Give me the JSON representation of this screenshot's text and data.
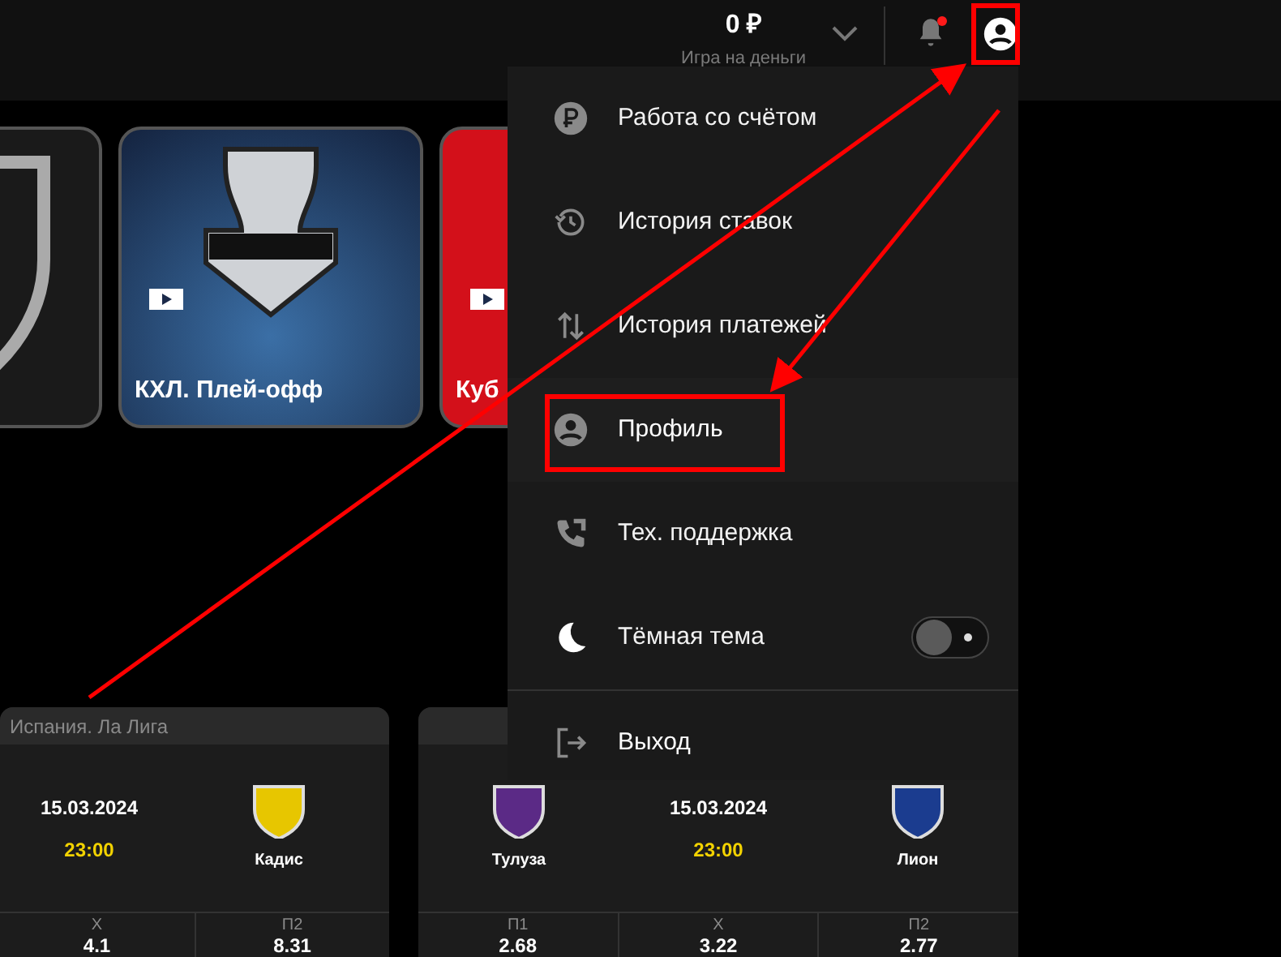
{
  "header": {
    "balance": "0 ₽",
    "balance_caption": "Игра на деньги",
    "notifications_unread": true
  },
  "banners": [
    {
      "kind": "shield"
    },
    {
      "kind": "kxl",
      "label": "КХЛ. Плей-офф"
    },
    {
      "kind": "red",
      "label": "Куб"
    }
  ],
  "matches": [
    {
      "league": "Испания. Ла Лига",
      "away": "Кадис",
      "date": "15.03.2024",
      "time": "23:00",
      "odds": [
        {
          "label": "Х",
          "value": "4.1"
        },
        {
          "label": "П2",
          "value": "8.31"
        }
      ]
    },
    {
      "home": "Тулуза",
      "away": "Лион",
      "date": "15.03.2024",
      "time": "23:00",
      "odds": [
        {
          "label": "П1",
          "value": "2.68"
        },
        {
          "label": "Х",
          "value": "3.22"
        },
        {
          "label": "П2",
          "value": "2.77"
        }
      ]
    }
  ],
  "menu": {
    "items": [
      {
        "kind": "account",
        "label": "Работа со счётом",
        "highlighted": false
      },
      {
        "kind": "history",
        "label": "История ставок",
        "highlighted": false
      },
      {
        "kind": "payments",
        "label": "История платежей",
        "highlighted": false
      },
      {
        "kind": "profile",
        "label": "Профиль",
        "highlighted": true
      },
      {
        "kind": "support",
        "label": "Тех. поддержка",
        "highlighted": false
      },
      {
        "kind": "theme",
        "label": "Тёмная тема",
        "highlighted": false,
        "on": false
      }
    ],
    "logout": "Выход"
  }
}
